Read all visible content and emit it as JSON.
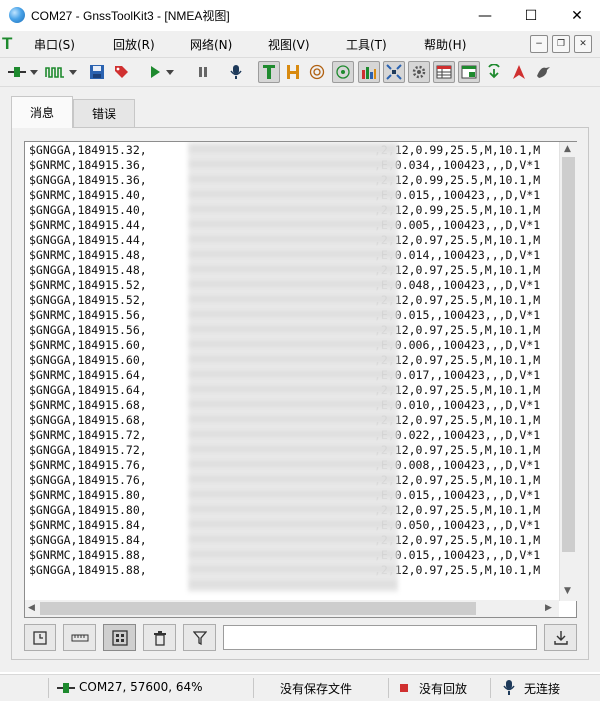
{
  "window": {
    "title": "COM27 - GnssToolKit3 - [NMEA视图]"
  },
  "menu": [
    "串口(S)",
    "回放(R)",
    "网络(N)",
    "视图(V)",
    "工具(T)",
    "帮助(H)"
  ],
  "toolbar": {
    "icons": [
      "connect-icon",
      "dropdown-arrow-icon",
      "baud-wave-icon",
      "dropdown-arrow-icon",
      "save-icon",
      "tag-icon",
      "play-icon",
      "dropdown-arrow-icon",
      "pause-icon",
      "microphone-icon",
      "text-t-icon",
      "letter-h-icon",
      "target-icon",
      "crosshair-icon",
      "bar-chart-icon",
      "satellite-icon",
      "gear-icon",
      "table-icon",
      "chart-table-icon",
      "download-icon",
      "navigation-arrow-icon",
      "bird-icon"
    ]
  },
  "tabs": [
    "消息",
    "错误"
  ],
  "log": {
    "lines": [
      "$GNGGA,184915.32,",
      "$GNRMC,184915.36,",
      "$GNGGA,184915.36,",
      "$GNRMC,184915.40,",
      "$GNGGA,184915.40,",
      "$GNRMC,184915.44,",
      "$GNGGA,184915.44,",
      "$GNRMC,184915.48,",
      "$GNGGA,184915.48,",
      "$GNRMC,184915.52,",
      "$GNGGA,184915.52,",
      "$GNRMC,184915.56,",
      "$GNGGA,184915.56,",
      "$GNRMC,184915.60,",
      "$GNGGA,184915.60,",
      "$GNRMC,184915.64,",
      "$GNGGA,184915.64,",
      "$GNRMC,184915.68,",
      "$GNGGA,184915.68,",
      "$GNRMC,184915.72,",
      "$GNGGA,184915.72,",
      "$GNRMC,184915.76,",
      "$GNGGA,184915.76,",
      "$GNRMC,184915.80,",
      "$GNGGA,184915.80,",
      "$GNRMC,184915.84,",
      "$GNGGA,184915.84,",
      "$GNRMC,184915.88,",
      "$GNGGA,184915.88,"
    ],
    "tails": [
      ",2,12,0.99,25.5,M,10.1,M",
      ",E,0.034,,100423,,,D,V*1",
      ",2,12,0.99,25.5,M,10.1,M",
      ",E,0.015,,100423,,,D,V*1",
      ",2,12,0.99,25.5,M,10.1,M",
      ",E,0.005,,100423,,,D,V*1",
      ",2,12,0.97,25.5,M,10.1,M",
      ",E,0.014,,100423,,,D,V*1",
      ",2,12,0.97,25.5,M,10.1,M",
      ",E,0.048,,100423,,,D,V*1",
      ",2,12,0.97,25.5,M,10.1,M",
      ",E,0.015,,100423,,,D,V*1",
      ",2,12,0.97,25.5,M,10.1,M",
      ",E,0.006,,100423,,,D,V*1",
      ",2,12,0.97,25.5,M,10.1,M",
      ",E,0.017,,100423,,,D,V*1",
      ",2,12,0.97,25.5,M,10.1,M",
      ",E,0.010,,100423,,,D,V*1",
      ",2,12,0.97,25.5,M,10.1,M",
      ",E,0.022,,100423,,,D,V*1",
      ",2,12,0.97,25.5,M,10.1,M",
      ",E,0.008,,100423,,,D,V*1",
      ",2,12,0.97,25.5,M,10.1,M",
      ",E,0.015,,100423,,,D,V*1",
      ",2,12,0.97,25.5,M,10.1,M",
      ",E,0.050,,100423,,,D,V*1",
      ",2,12,0.97,25.5,M,10.1,M",
      ",E,0.015,,100423,,,D,V*1",
      ",2,12,0.97,25.5,M,10.1,M"
    ]
  },
  "filter": {
    "value": ""
  },
  "status": {
    "port": "COM27, 57600, 64%",
    "save": "没有保存文件",
    "playback": "没有回放",
    "connection": "无连接"
  },
  "colors": {
    "accent": "#1e8a2e",
    "record_dot": "#d03030"
  }
}
